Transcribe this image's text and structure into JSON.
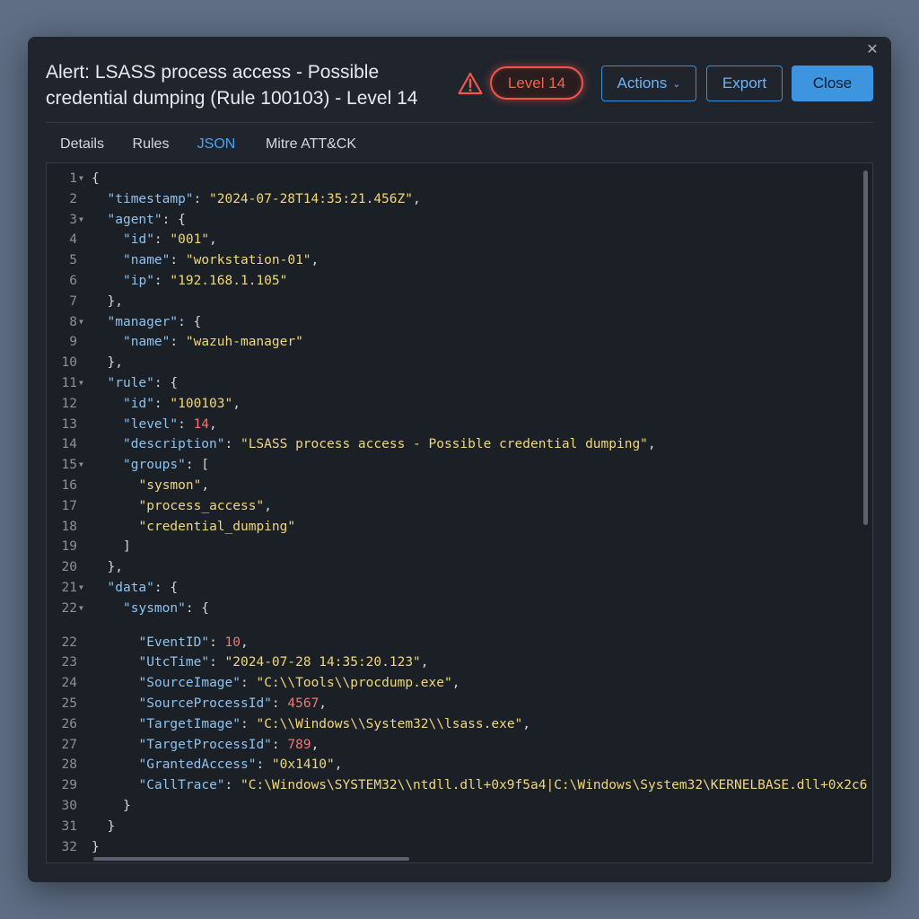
{
  "title": "Alert: LSASS process access - Possible credential dumping (Rule 100103) - Level 14",
  "level_badge": "Level 14",
  "buttons": {
    "actions": "Actions",
    "export": "Export",
    "close": "Close"
  },
  "tabs": [
    "Details",
    "Rules",
    "JSON",
    "Mitre ATT&CK"
  ],
  "active_tab": "JSON",
  "colors": {
    "accent": "#3d95df",
    "danger": "#f0564a",
    "json_key": "#8ec3f0",
    "json_string": "#f0d77b",
    "json_number": "#f07772"
  },
  "icons": {
    "warning": "warning-triangle-icon",
    "close": "close-icon",
    "dropdown": "chevron-down-icon",
    "fold": "fold-arrow-icon"
  },
  "json_lines": [
    {
      "n": "1",
      "fold": true,
      "indent": 0,
      "tokens": [
        [
          "p",
          "{"
        ]
      ]
    },
    {
      "n": "2",
      "fold": false,
      "indent": 1,
      "tokens": [
        [
          "k",
          "\"timestamp\""
        ],
        [
          "p",
          ": "
        ],
        [
          "s",
          "\"2024-07-28T14:35:21.456Z\""
        ],
        [
          "p",
          ","
        ]
      ]
    },
    {
      "n": "3",
      "fold": true,
      "indent": 1,
      "tokens": [
        [
          "k",
          "\"agent\""
        ],
        [
          "p",
          ": {"
        ]
      ]
    },
    {
      "n": "4",
      "fold": false,
      "indent": 2,
      "tokens": [
        [
          "k",
          "\"id\""
        ],
        [
          "p",
          ": "
        ],
        [
          "s",
          "\"001\""
        ],
        [
          "p",
          ","
        ]
      ]
    },
    {
      "n": "5",
      "fold": false,
      "indent": 2,
      "tokens": [
        [
          "k",
          "\"name\""
        ],
        [
          "p",
          ": "
        ],
        [
          "s",
          "\"workstation-01\""
        ],
        [
          "p",
          ","
        ]
      ]
    },
    {
      "n": "6",
      "fold": false,
      "indent": 2,
      "tokens": [
        [
          "k",
          "\"ip\""
        ],
        [
          "p",
          ": "
        ],
        [
          "s",
          "\"192.168.1.105\""
        ]
      ]
    },
    {
      "n": "7",
      "fold": false,
      "indent": 1,
      "tokens": [
        [
          "p",
          "},"
        ]
      ]
    },
    {
      "n": "8",
      "fold": true,
      "indent": 1,
      "tokens": [
        [
          "k",
          "\"manager\""
        ],
        [
          "p",
          ": {"
        ]
      ]
    },
    {
      "n": "9",
      "fold": false,
      "indent": 2,
      "tokens": [
        [
          "k",
          "\"name\""
        ],
        [
          "p",
          ": "
        ],
        [
          "s",
          "\"wazuh-manager\""
        ]
      ]
    },
    {
      "n": "10",
      "fold": false,
      "indent": 1,
      "tokens": [
        [
          "p",
          "},"
        ]
      ]
    },
    {
      "n": "11",
      "fold": true,
      "indent": 1,
      "tokens": [
        [
          "k",
          "\"rule\""
        ],
        [
          "p",
          ": {"
        ]
      ]
    },
    {
      "n": "12",
      "fold": false,
      "indent": 2,
      "tokens": [
        [
          "k",
          "\"id\""
        ],
        [
          "p",
          ": "
        ],
        [
          "s",
          "\"100103\""
        ],
        [
          "p",
          ","
        ]
      ]
    },
    {
      "n": "13",
      "fold": false,
      "indent": 2,
      "tokens": [
        [
          "k",
          "\"level\""
        ],
        [
          "p",
          ": "
        ],
        [
          "n",
          "14"
        ],
        [
          "p",
          ","
        ]
      ]
    },
    {
      "n": "14",
      "fold": false,
      "indent": 2,
      "tokens": [
        [
          "k",
          "\"description\""
        ],
        [
          "p",
          ": "
        ],
        [
          "s",
          "\"LSASS process access - Possible credential dumping\""
        ],
        [
          "p",
          ","
        ]
      ]
    },
    {
      "n": "15",
      "fold": true,
      "indent": 2,
      "tokens": [
        [
          "k",
          "\"groups\""
        ],
        [
          "p",
          ": ["
        ]
      ]
    },
    {
      "n": "16",
      "fold": false,
      "indent": 3,
      "tokens": [
        [
          "s",
          "\"sysmon\""
        ],
        [
          "p",
          ","
        ]
      ]
    },
    {
      "n": "17",
      "fold": false,
      "indent": 3,
      "tokens": [
        [
          "s",
          "\"process_access\""
        ],
        [
          "p",
          ","
        ]
      ]
    },
    {
      "n": "18",
      "fold": false,
      "indent": 3,
      "tokens": [
        [
          "s",
          "\"credential_dumping\""
        ]
      ]
    },
    {
      "n": "19",
      "fold": false,
      "indent": 2,
      "tokens": [
        [
          "p",
          "]"
        ]
      ]
    },
    {
      "n": "20",
      "fold": false,
      "indent": 1,
      "tokens": [
        [
          "p",
          "},"
        ]
      ]
    },
    {
      "n": "21",
      "fold": true,
      "indent": 1,
      "tokens": [
        [
          "k",
          "\"data\""
        ],
        [
          "p",
          ": {"
        ]
      ]
    },
    {
      "n": "22",
      "fold": true,
      "indent": 2,
      "tokens": [
        [
          "k",
          "\"sysmon\""
        ],
        [
          "p",
          ": {"
        ]
      ]
    },
    {
      "n": "22",
      "fold": false,
      "indent": 3,
      "tokens": [
        [
          "k",
          "\"EventID\""
        ],
        [
          "p",
          ": "
        ],
        [
          "n",
          "10"
        ],
        [
          "p",
          ","
        ]
      ]
    },
    {
      "n": "23",
      "fold": false,
      "indent": 3,
      "tokens": [
        [
          "k",
          "\"UtcTime\""
        ],
        [
          "p",
          ": "
        ],
        [
          "s",
          "\"2024-07-28 14:35:20.123\""
        ],
        [
          "p",
          ","
        ]
      ]
    },
    {
      "n": "24",
      "fold": false,
      "indent": 3,
      "tokens": [
        [
          "k",
          "\"SourceImage\""
        ],
        [
          "p",
          ": "
        ],
        [
          "s",
          "\"C:\\\\Tools\\\\procdump.exe\""
        ],
        [
          "p",
          ","
        ]
      ]
    },
    {
      "n": "25",
      "fold": false,
      "indent": 3,
      "tokens": [
        [
          "k",
          "\"SourceProcessId\""
        ],
        [
          "p",
          ": "
        ],
        [
          "n",
          "4567"
        ],
        [
          "p",
          ","
        ]
      ]
    },
    {
      "n": "26",
      "fold": false,
      "indent": 3,
      "tokens": [
        [
          "k",
          "\"TargetImage\""
        ],
        [
          "p",
          ": "
        ],
        [
          "s",
          "\"C:\\\\Windows\\\\System32\\\\lsass.exe\""
        ],
        [
          "p",
          ","
        ]
      ]
    },
    {
      "n": "27",
      "fold": false,
      "indent": 3,
      "tokens": [
        [
          "k",
          "\"TargetProcessId\""
        ],
        [
          "p",
          ": "
        ],
        [
          "n",
          "789"
        ],
        [
          "p",
          ","
        ]
      ]
    },
    {
      "n": "28",
      "fold": false,
      "indent": 3,
      "tokens": [
        [
          "k",
          "\"GrantedAccess\""
        ],
        [
          "p",
          ": "
        ],
        [
          "s",
          "\"0x1410\""
        ],
        [
          "p",
          ","
        ]
      ]
    },
    {
      "n": "29",
      "fold": false,
      "indent": 3,
      "tokens": [
        [
          "k",
          "\"CallTrace\""
        ],
        [
          "p",
          ": "
        ],
        [
          "s",
          "\"C:\\Windows\\SYSTEM32\\\\ntdll.dll+0x9f5a4|C:\\Windows\\System32\\KERNELBASE.dll+0x2c6"
        ]
      ]
    },
    {
      "n": "30",
      "fold": false,
      "indent": 2,
      "tokens": [
        [
          "p",
          "}"
        ]
      ]
    },
    {
      "n": "31",
      "fold": false,
      "indent": 1,
      "tokens": [
        [
          "p",
          "}"
        ]
      ]
    },
    {
      "n": "32",
      "fold": false,
      "indent": 0,
      "tokens": [
        [
          "p",
          "}"
        ]
      ]
    }
  ]
}
